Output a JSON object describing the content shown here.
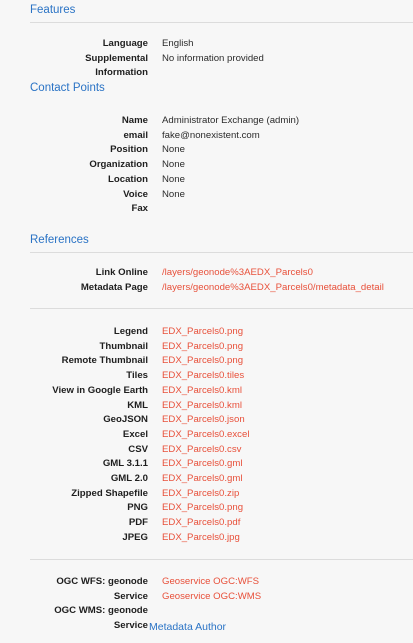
{
  "features": {
    "heading": "Features",
    "rows": [
      {
        "label": "Language",
        "value": "English"
      },
      {
        "label": "Supplemental",
        "value": "No information provided"
      },
      {
        "label": "Information",
        "value": ""
      }
    ]
  },
  "contact_points": {
    "heading": "Contact Points",
    "rows": [
      {
        "label": "Name",
        "value": "Administrator Exchange (admin)"
      },
      {
        "label": "email",
        "value": "fake@nonexistent.com"
      },
      {
        "label": "Position",
        "value": "None"
      },
      {
        "label": "Organization",
        "value": "None"
      },
      {
        "label": "Location",
        "value": "None"
      },
      {
        "label": "Voice",
        "value": "None"
      },
      {
        "label": "Fax",
        "value": ""
      }
    ]
  },
  "references": {
    "heading": "References",
    "links": [
      {
        "label": "Link Online",
        "value": "/layers/geonode%3AEDX_Parcels0"
      },
      {
        "label": "Metadata Page",
        "value": "/layers/geonode%3AEDX_Parcels0/metadata_detail"
      }
    ],
    "downloads": [
      {
        "label": "Legend",
        "value": "EDX_Parcels0.png"
      },
      {
        "label": "Thumbnail",
        "value": "EDX_Parcels0.png"
      },
      {
        "label": "Remote Thumbnail",
        "value": "EDX_Parcels0.png"
      },
      {
        "label": "Tiles",
        "value": "EDX_Parcels0.tiles"
      },
      {
        "label": "View in Google Earth",
        "value": "EDX_Parcels0.kml"
      },
      {
        "label": "KML",
        "value": "EDX_Parcels0.kml"
      },
      {
        "label": "GeoJSON",
        "value": "EDX_Parcels0.json"
      },
      {
        "label": "Excel",
        "value": "EDX_Parcels0.excel"
      },
      {
        "label": "CSV",
        "value": "EDX_Parcels0.csv"
      },
      {
        "label": "GML 3.1.1",
        "value": "EDX_Parcels0.gml"
      },
      {
        "label": "GML 2.0",
        "value": "EDX_Parcels0.gml"
      },
      {
        "label": "Zipped Shapefile",
        "value": "EDX_Parcels0.zip"
      },
      {
        "label": "PNG",
        "value": "EDX_Parcels0.png"
      },
      {
        "label": "PDF",
        "value": "EDX_Parcels0.pdf"
      },
      {
        "label": "JPEG",
        "value": "EDX_Parcels0.jpg"
      }
    ],
    "services": [
      {
        "label": "OGC WFS: geonode",
        "value": "Geoservice OGC:WFS"
      },
      {
        "label": "Service",
        "value": "Geoservice OGC:WMS"
      },
      {
        "label": "OGC WMS: geonode",
        "value": ""
      },
      {
        "label": "Service",
        "value": ""
      }
    ]
  },
  "metadata_author": {
    "heading": "Metadata Author"
  },
  "colors": {
    "heading": "#2a73c5",
    "link": "#e8503a",
    "background": "#f7f7f7"
  }
}
